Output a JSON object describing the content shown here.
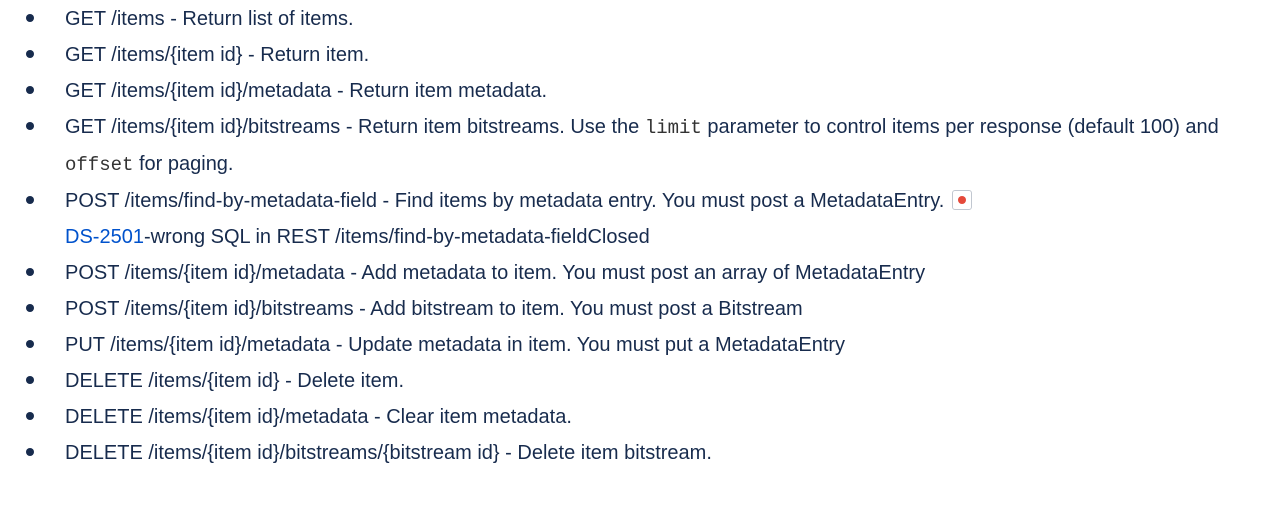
{
  "endpoints": [
    {
      "text": "GET /items - Return list of items."
    },
    {
      "text": "GET /items/{item id} - Return item."
    },
    {
      "text": "GET /items/{item id}/metadata - Return item metadata."
    },
    {
      "text_a": "GET /items/{item id}/bitstreams - Return item bitstreams. Use the ",
      "code_a": "limit",
      "text_b": " parameter to control items per response (default 100) and ",
      "code_b": "offset",
      "text_c": " for paging."
    },
    {
      "text": "POST /items/find-by-metadata-field - Find items by metadata entry. You must post a MetadataEntry.",
      "issue_icon": "bug-icon",
      "issue_key": "DS-2501",
      "issue_summary": "-wrong SQL in REST /items/find-by-metadata-field",
      "issue_status": "Closed"
    },
    {
      "text": "POST /items/{item id}/metadata - Add metadata to item. You must post an array of MetadataEntry"
    },
    {
      "text": "POST /items/{item id}/bitstreams - Add bitstream to item. You must post a Bitstream"
    },
    {
      "text": "PUT /items/{item id}/metadata - Update metadata in item. You must put a MetadataEntry"
    },
    {
      "text": "DELETE /items/{item id} - Delete item."
    },
    {
      "text": "DELETE /items/{item id}/metadata - Clear item metadata."
    },
    {
      "text": "DELETE /items/{item id}/bitstreams/{bitstream id} - Delete item bitstream."
    }
  ],
  "colors": {
    "text": "#172b4d",
    "link": "#0052cc",
    "issue_icon": "#e5493a"
  }
}
